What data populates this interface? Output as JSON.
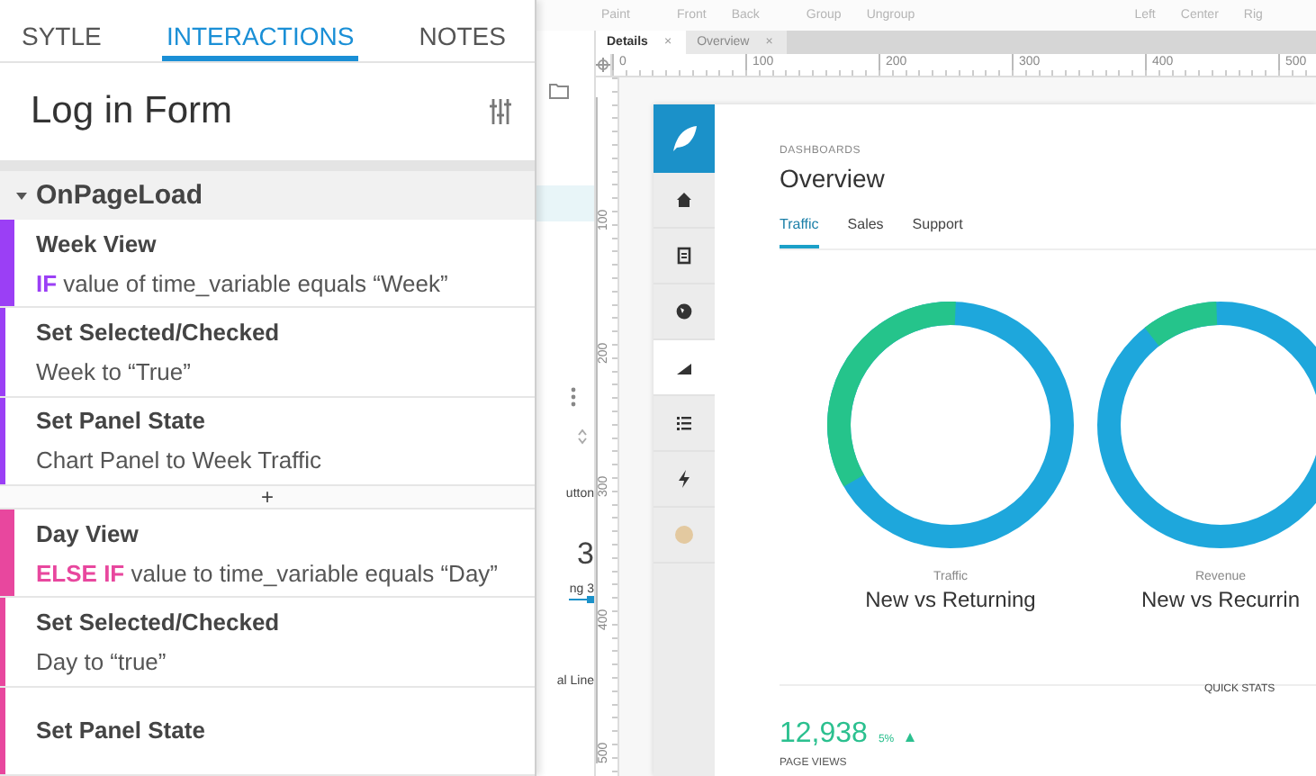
{
  "left_panel": {
    "tabs": [
      {
        "label": "SYTLE",
        "selected": false
      },
      {
        "label": "INTERACTIONS",
        "selected": true
      },
      {
        "label": "NOTES",
        "selected": false
      }
    ],
    "title": "Log in Form",
    "event": {
      "label": "OnPageLoad",
      "expanded": true,
      "separator": "+",
      "cases": [
        {
          "name": "Week View",
          "keyword": "IF",
          "condition": "value of time_variable equals “Week”",
          "color": "#9b3ff5",
          "actions": [
            {
              "name": "Set Selected/Checked",
              "detail": "Week to “True”"
            },
            {
              "name": "Set Panel State",
              "detail": "Chart Panel to Week Traffic"
            }
          ]
        },
        {
          "name": "Day View",
          "keyword": "ELSE IF",
          "condition": "value to time_variable equals “Day”",
          "color": "#e8479e",
          "actions": [
            {
              "name": "Set Selected/Checked",
              "detail": "Day to “true”"
            },
            {
              "name": "Set Panel State"
            }
          ]
        }
      ]
    }
  },
  "toolbar": {
    "groups": [
      [
        "Paint"
      ],
      [
        "Front",
        "Back"
      ],
      [
        "Group",
        "Ungroup"
      ],
      [
        "Left",
        "Center",
        "Rig"
      ]
    ]
  },
  "layers_strip": {
    "fragments": [
      "utton",
      "3",
      "ng 3",
      "al Line"
    ]
  },
  "document_tabs": [
    {
      "label": "Details",
      "close": "×",
      "selected": true
    },
    {
      "label": "Overview",
      "close": "×",
      "selected": false
    }
  ],
  "rulers": {
    "horizontal": [
      "0",
      "100",
      "200",
      "300",
      "400",
      "500"
    ],
    "vertical": [
      "100",
      "200",
      "300",
      "400",
      "500"
    ]
  },
  "dashboard": {
    "nav": [
      {
        "kind": "home",
        "selected": false
      },
      {
        "kind": "document",
        "selected": false
      },
      {
        "kind": "globe",
        "selected": false
      },
      {
        "kind": "chart",
        "selected": true
      },
      {
        "kind": "list",
        "selected": false
      },
      {
        "kind": "bolt",
        "selected": false
      },
      {
        "kind": "avatar",
        "selected": false
      }
    ],
    "breadcrumb": "DASHBOARDS",
    "title": "Overview",
    "tabs": [
      {
        "label": "Traffic",
        "selected": true
      },
      {
        "label": "Sales",
        "selected": false
      },
      {
        "label": "Support",
        "selected": false
      }
    ],
    "donuts": [
      {
        "caption": "Traffic",
        "title": "New vs Returning"
      },
      {
        "caption": "Revenue",
        "title": "New vs Recurrin"
      }
    ],
    "quick_stats": {
      "label": "QUICK STATS",
      "stats": [
        {
          "value": "12,938",
          "change": "5%",
          "label": "PAGE VIEWS"
        }
      ]
    }
  }
}
